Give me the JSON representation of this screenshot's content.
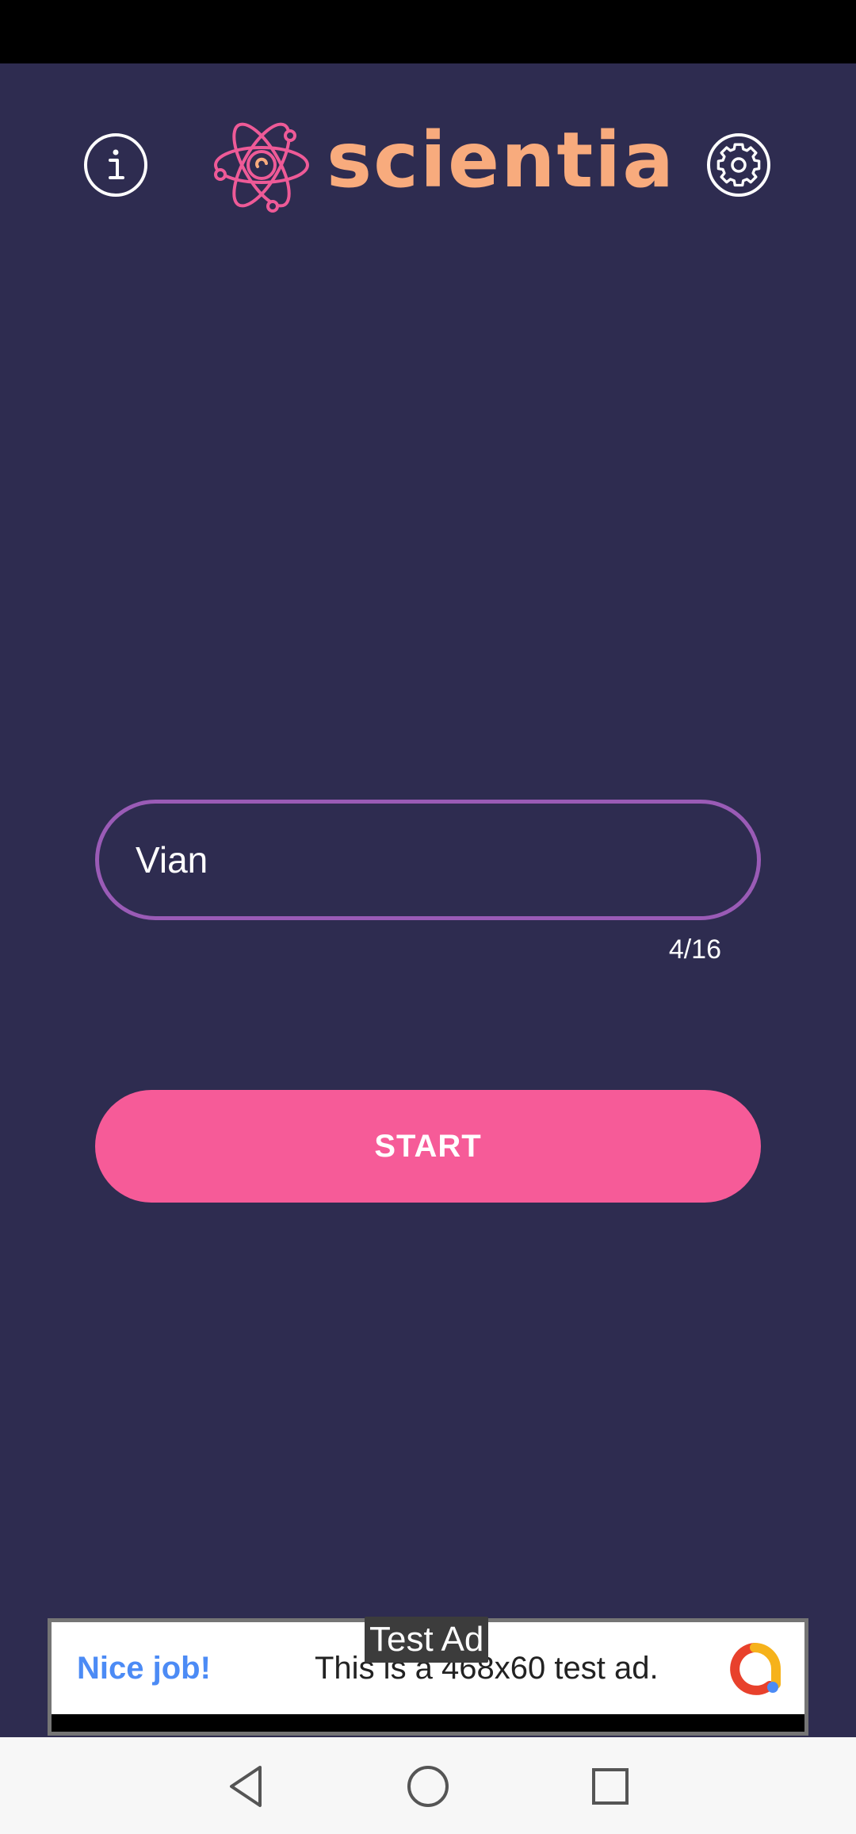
{
  "app": {
    "name": "scientia",
    "logo_text": "scientia",
    "logo_icon": "atom-icon"
  },
  "header": {
    "info_icon": "info-icon",
    "settings_icon": "gear-icon"
  },
  "name_input": {
    "value": "Vian",
    "counter": "4/16"
  },
  "start_button": {
    "label": "START"
  },
  "ad": {
    "badge": "Test Ad",
    "headline": "Nice job!",
    "body": "This is a 468x60 test ad.",
    "logo_icon": "admob-logo-icon"
  },
  "nav": {
    "back_icon": "back-triangle-icon",
    "home_icon": "home-circle-icon",
    "recents_icon": "recents-square-icon"
  },
  "colors": {
    "background": "#2e2c50",
    "accent_pink": "#f65b98",
    "logo_orange": "#f8ab7d",
    "field_border": "#9a5bb6",
    "ad_headline": "#4c8bf5"
  }
}
